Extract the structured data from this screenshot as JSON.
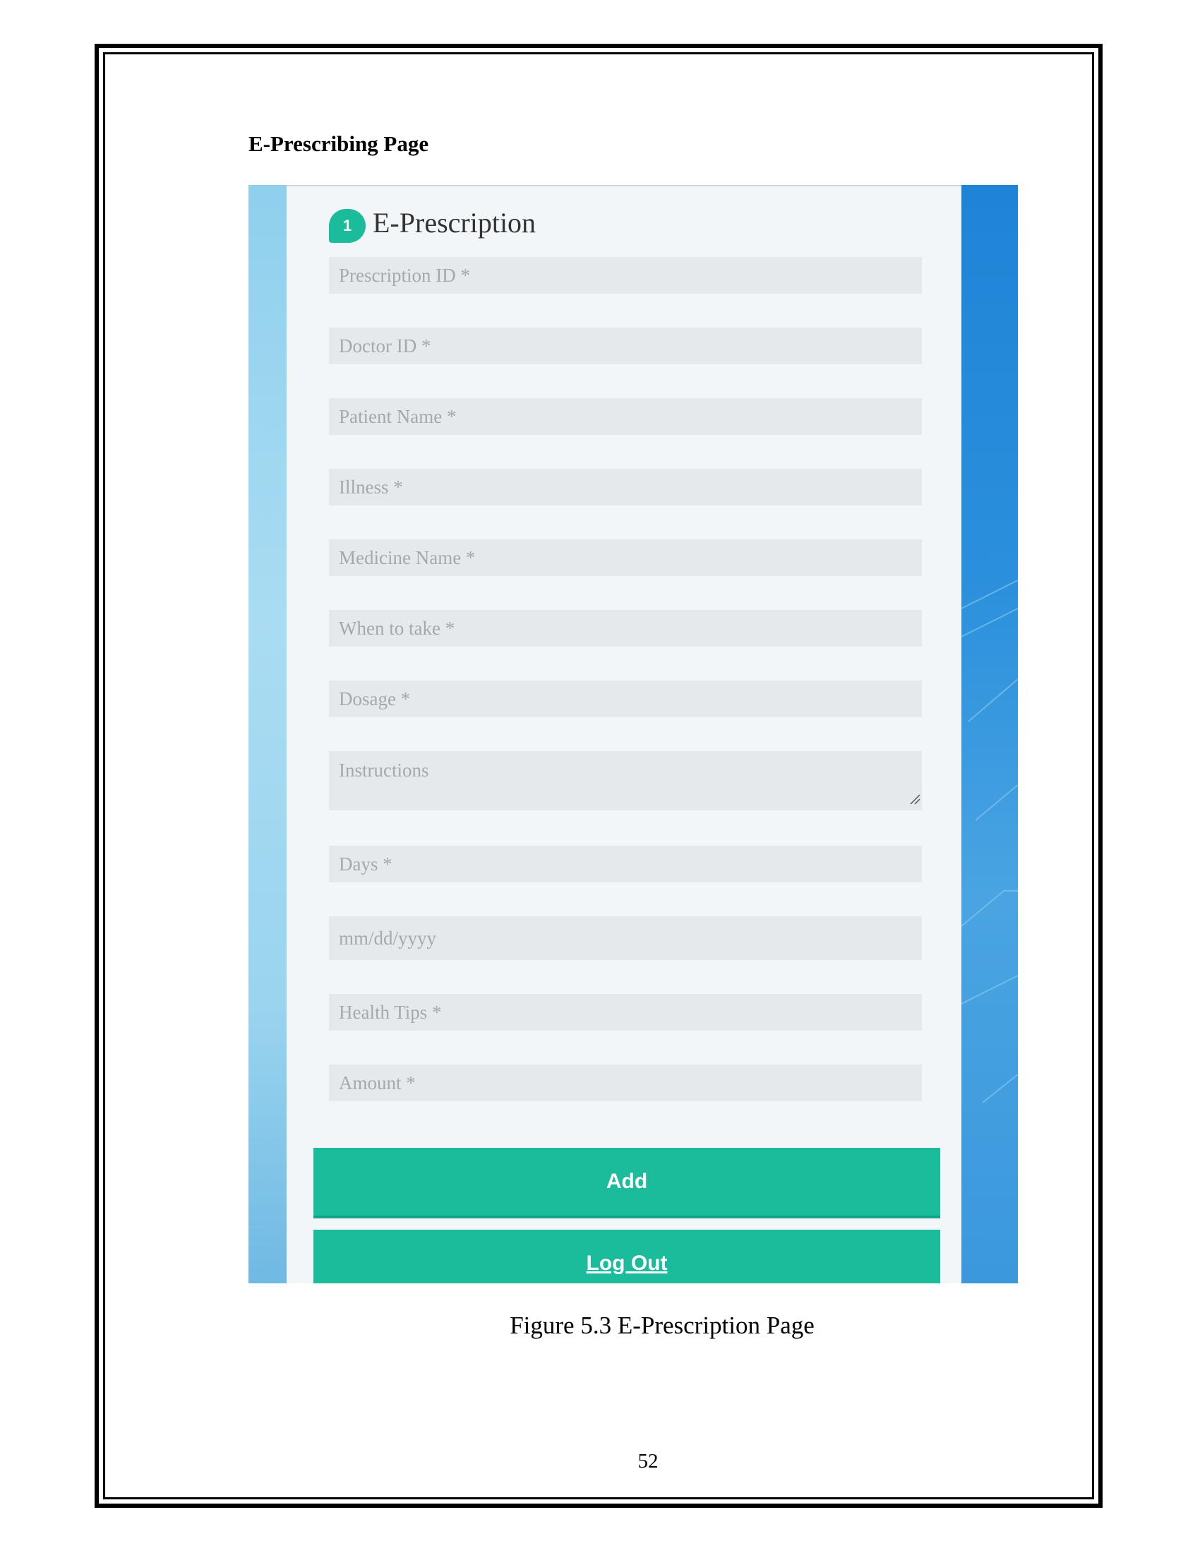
{
  "document": {
    "section_heading": "E-Prescribing Page",
    "figure_caption": "Figure 5.3 E-Prescription Page",
    "page_number": "52"
  },
  "form": {
    "step_number": "1",
    "title": "E-Prescription",
    "fields": {
      "prescription_id": "Prescription ID *",
      "doctor_id": "Doctor ID *",
      "patient_name": "Patient Name *",
      "illness": "Illness *",
      "medicine_name": "Medicine Name *",
      "when_to_take": "When to take *",
      "dosage": "Dosage *",
      "instructions": "Instructions",
      "days": "Days *",
      "date": "mm/dd/yyyy",
      "health_tips": "Health Tips *",
      "amount": "Amount *"
    },
    "add_label": "Add",
    "logout_label": "Log Out"
  },
  "colors": {
    "accent": "#1bbc9b",
    "field_background": "#e6e9ec",
    "card_background": "#f3f6f8"
  }
}
